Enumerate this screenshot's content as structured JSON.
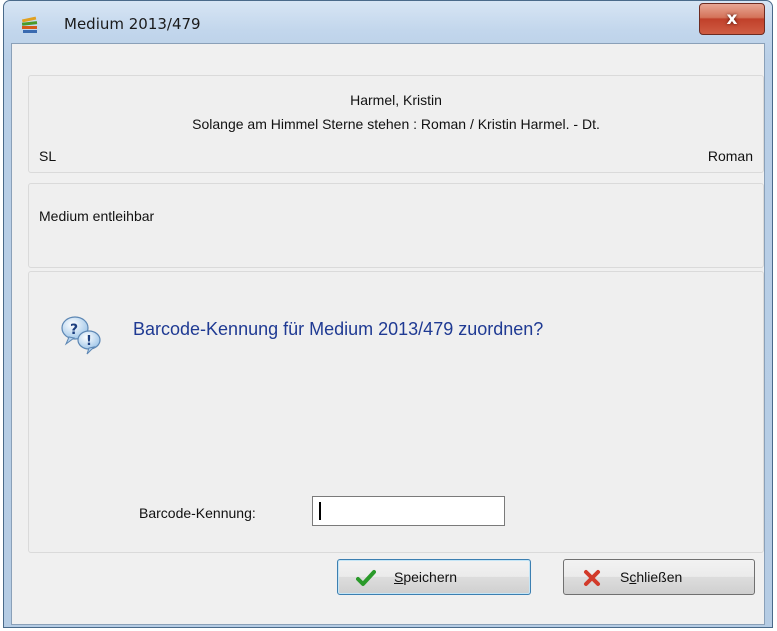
{
  "window": {
    "title": "Medium 2013/479",
    "close_label": "x"
  },
  "info": {
    "author": "Harmel, Kristin",
    "title_line": "Solange am Himmel Sterne stehen : Roman / Kristin Harmel. - Dt.",
    "left_code": "SL",
    "right_genre": "Roman"
  },
  "status": {
    "text": "Medium entleihbar"
  },
  "prompt": {
    "question": "Barcode-Kennung für Medium 2013/479 zuordnen?",
    "barcode_label": "Barcode-Kennung:",
    "barcode_value": ""
  },
  "buttons": {
    "save": {
      "first": "S",
      "rest": "peichern",
      "icon": "checkmark-icon"
    },
    "close": {
      "pre": "S",
      "mnemonic": "c",
      "rest": "hließen",
      "icon": "cross-icon"
    }
  },
  "colors": {
    "question_text": "#1f3a93",
    "title_bar": "#c2d6ec",
    "close_button": "#c0402a"
  }
}
